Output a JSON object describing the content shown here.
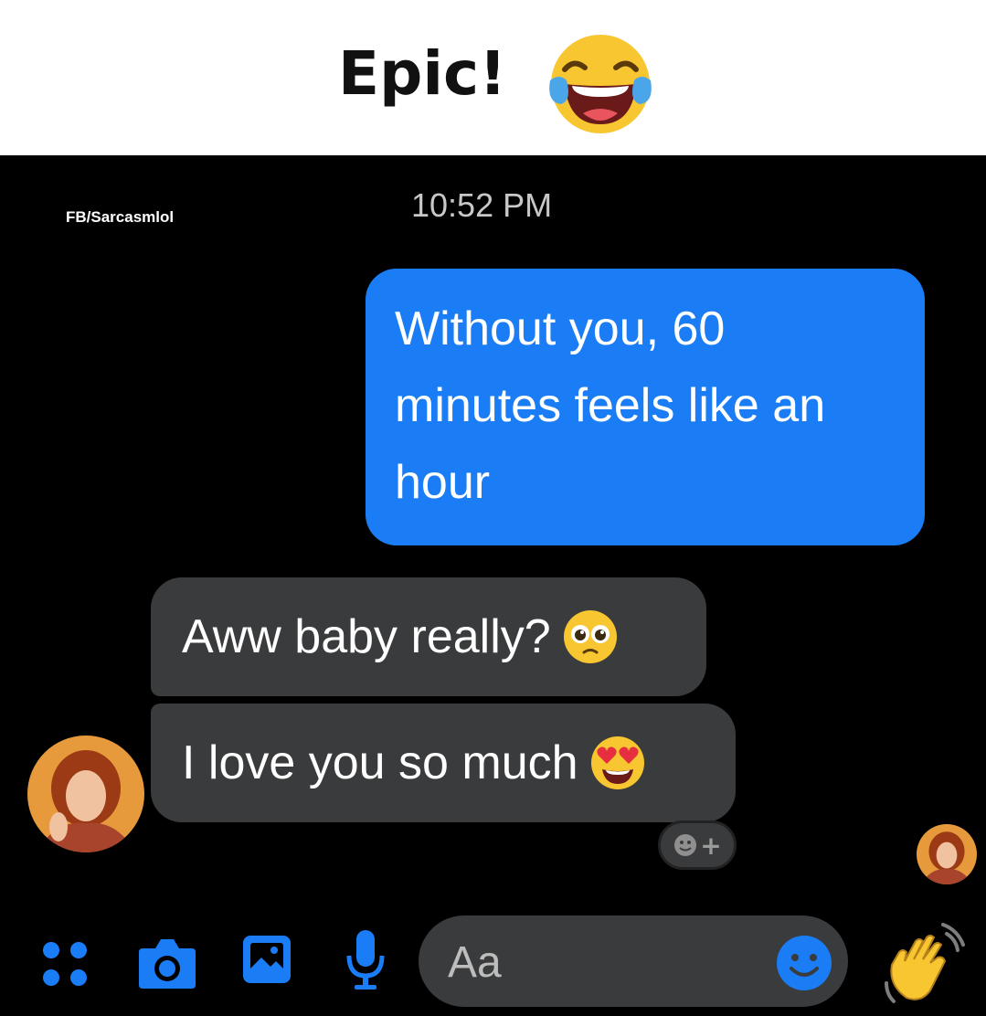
{
  "caption": {
    "title": "Epic!",
    "emoji": "face-with-tears-of-joy-icon"
  },
  "chat": {
    "watermark": "FB/Sarcasmlol",
    "timestamp": "10:52 PM",
    "messages": [
      {
        "direction": "outgoing",
        "text": "Without you, 60 minutes feels like an hour"
      },
      {
        "direction": "incoming",
        "text": "Aww baby really?",
        "emoji": "pleading-face-icon"
      },
      {
        "direction": "incoming",
        "text": "I love you so much",
        "emoji": "heart-eyes-icon"
      }
    ],
    "reaction_button": "add-reaction-icon"
  },
  "composer": {
    "placeholder": "Aa",
    "tools": [
      "menu-dots-icon",
      "camera-icon",
      "gallery-icon",
      "microphone-icon"
    ],
    "emoji_button": "smile-icon",
    "send_button": "waving-hand-icon"
  },
  "colors": {
    "outgoing_bubble": "#1a7df5",
    "incoming_bubble": "#3a3b3c",
    "accent": "#1a7df5",
    "background": "#000000"
  }
}
